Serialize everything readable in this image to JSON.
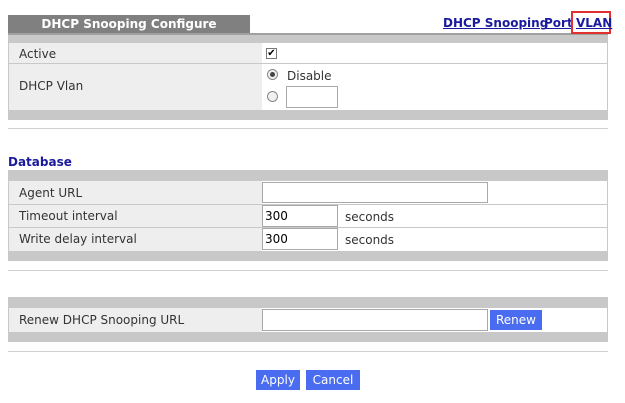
{
  "header": {
    "title": "DHCP Snooping Configure",
    "links": {
      "dhcp_snooping": "DHCP Snooping",
      "port": "Port",
      "vlan": "VLAN"
    }
  },
  "config": {
    "active_label": "Active",
    "active_checked": true,
    "active_check_glyph": "✔",
    "dhcp_vlan_label": "DHCP Vlan",
    "disable_label": "Disable",
    "selected_option": "Disable",
    "vlan_value": ""
  },
  "database": {
    "title": "Database",
    "agent_url_label": "Agent URL",
    "agent_url_value": "",
    "timeout_label": "Timeout interval",
    "timeout_value": "300",
    "timeout_unit": "seconds",
    "write_delay_label": "Write delay interval",
    "write_delay_value": "300",
    "write_delay_unit": "seconds"
  },
  "renew": {
    "label": "Renew DHCP Snooping URL",
    "url_value": "",
    "button": "Renew"
  },
  "footer": {
    "apply": "Apply",
    "cancel": "Cancel"
  },
  "colors": {
    "link": "#1a1a9e",
    "button": "#4a6cf0",
    "highlight_border": "#e03030",
    "title_tab": "#808080"
  }
}
